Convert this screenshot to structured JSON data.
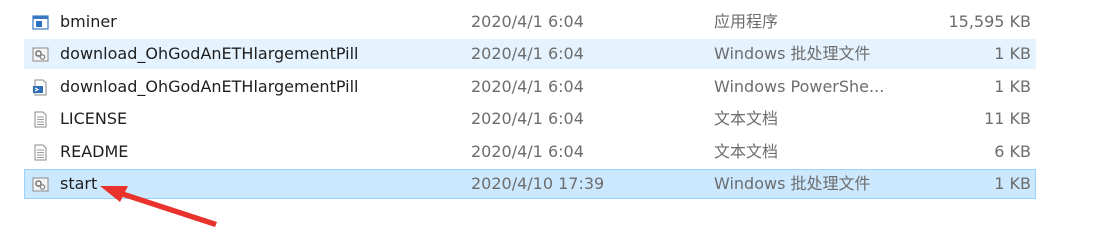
{
  "files": [
    {
      "name": "bminer",
      "date": "2020/4/1 6:04",
      "type": "应用程序",
      "size": "15,595 KB",
      "icon": "application-icon",
      "state": "normal"
    },
    {
      "name": "download_OhGodAnETHlargementPill",
      "date": "2020/4/1 6:04",
      "type": "Windows 批处理文件",
      "size": "1 KB",
      "icon": "batch-file-icon",
      "state": "hover"
    },
    {
      "name": "download_OhGodAnETHlargementPill",
      "date": "2020/4/1 6:04",
      "type": "Windows PowerShe...",
      "size": "1 KB",
      "icon": "powershell-script-icon",
      "state": "normal"
    },
    {
      "name": "LICENSE",
      "date": "2020/4/1 6:04",
      "type": "文本文档",
      "size": "11 KB",
      "icon": "text-document-icon",
      "state": "normal"
    },
    {
      "name": "README",
      "date": "2020/4/1 6:04",
      "type": "文本文档",
      "size": "6 KB",
      "icon": "text-document-icon",
      "state": "normal"
    },
    {
      "name": "start",
      "date": "2020/4/10 17:39",
      "type": "Windows 批处理文件",
      "size": "1 KB",
      "icon": "batch-file-icon",
      "state": "selected"
    }
  ],
  "annotation": {
    "color": "#e8322b",
    "icon": "red-arrow-icon"
  }
}
